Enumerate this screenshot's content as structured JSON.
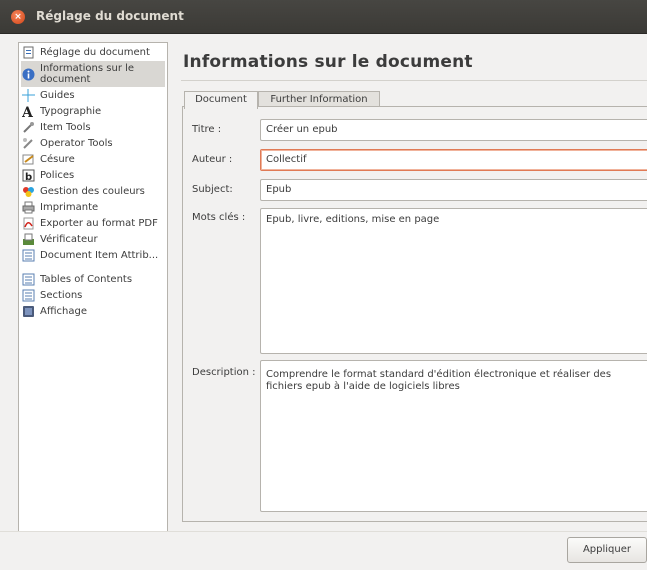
{
  "window": {
    "title": "Réglage du document",
    "close_glyph": "×"
  },
  "sidebar": {
    "items": [
      {
        "label": "Réglage du document",
        "icon": "document-settings-icon"
      },
      {
        "label": "Informations sur le document",
        "icon": "info-icon"
      },
      {
        "label": "Guides",
        "icon": "guides-icon"
      },
      {
        "label": "Typographie",
        "icon": "typography-icon"
      },
      {
        "label": "Item Tools",
        "icon": "item-tools-icon"
      },
      {
        "label": "Operator Tools",
        "icon": "operator-tools-icon"
      },
      {
        "label": "Césure",
        "icon": "hyphenation-icon"
      },
      {
        "label": "Polices",
        "icon": "fonts-icon"
      },
      {
        "label": "Gestion des couleurs",
        "icon": "color-management-icon"
      },
      {
        "label": "Imprimante",
        "icon": "printer-icon"
      },
      {
        "label": "Exporter au format PDF",
        "icon": "pdf-export-icon"
      },
      {
        "label": "Vérificateur",
        "icon": "preflight-icon"
      },
      {
        "label": "Document Item Attrib...",
        "icon": "item-attributes-icon"
      },
      {
        "label": "Tables of Contents",
        "icon": "toc-icon"
      },
      {
        "label": "Sections",
        "icon": "sections-icon"
      },
      {
        "label": "Affichage",
        "icon": "display-icon"
      }
    ],
    "selected_index": 1
  },
  "main": {
    "title": "Informations sur le document",
    "tabs": [
      {
        "label": "Document",
        "active": true
      },
      {
        "label": "Further Information",
        "active": false
      }
    ],
    "fields": {
      "titre": {
        "label": "Titre :",
        "value": "Créer un epub"
      },
      "auteur": {
        "label": "Auteur :",
        "value": "Collectif"
      },
      "subject": {
        "label": "Subject:",
        "value": "Epub"
      },
      "mots_cles": {
        "label": "Mots clés :",
        "value": "Epub, livre, editions, mise en page"
      },
      "description": {
        "label": "Description :",
        "value": "Comprendre le format standard d'édition électronique et réaliser des fichiers epub à l'aide de logiciels libres"
      }
    }
  },
  "footer": {
    "apply_label": "Appliquer"
  },
  "colors": {
    "accent_focus": "#e07a55",
    "titlebar": "#3b3a36",
    "close": "#d24517"
  }
}
